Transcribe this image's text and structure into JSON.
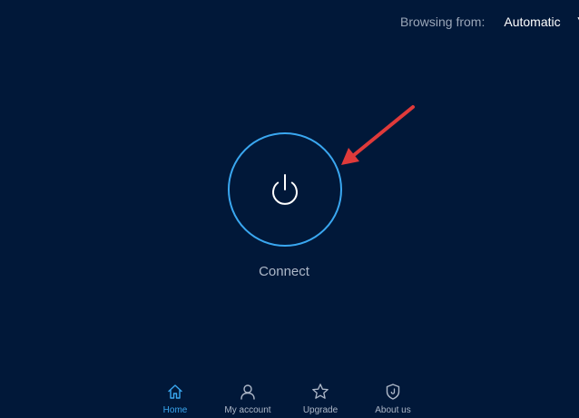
{
  "header": {
    "browsing_label": "Browsing from:",
    "browsing_value": "Automatic"
  },
  "main": {
    "connect_label": "Connect"
  },
  "nav": {
    "items": [
      {
        "label": "Home",
        "icon": "home-icon",
        "active": true
      },
      {
        "label": "My account",
        "icon": "user-icon",
        "active": false
      },
      {
        "label": "Upgrade",
        "icon": "star-icon",
        "active": false
      },
      {
        "label": "About us",
        "icon": "shield-icon",
        "active": false
      }
    ]
  },
  "colors": {
    "background": "#011839",
    "accent": "#3aa7f0",
    "annotation_arrow": "#e03a3a",
    "muted_text": "#aeb8c8"
  }
}
